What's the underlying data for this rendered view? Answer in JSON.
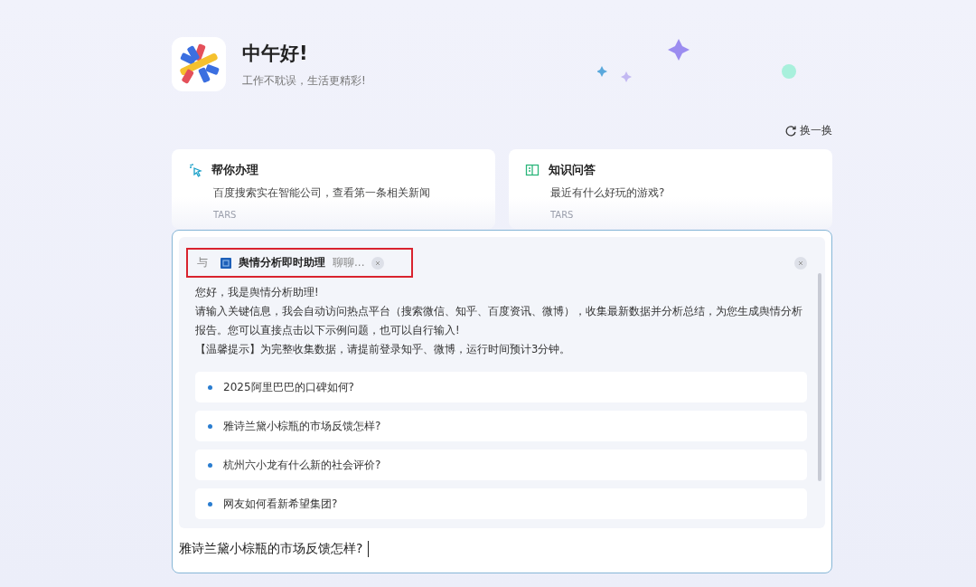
{
  "header": {
    "greeting": "中午好!",
    "subtitle": "工作不耽误，生活更精彩!"
  },
  "refresh_button": {
    "label": "换一换"
  },
  "cards": [
    {
      "kind": "task",
      "title": "帮你办理",
      "text": "百度搜索实在智能公司，查看第一条相关新闻",
      "source": "TARS"
    },
    {
      "kind": "knowledge",
      "title": "知识问答",
      "text": "最近有什么好玩的游戏?",
      "source": "TARS"
    }
  ],
  "chat": {
    "agent_bar": {
      "prefix": "与",
      "agent_name": "舆情分析即时助理",
      "suffix": "聊聊...",
      "highlighted": true
    },
    "intro": [
      "您好，我是舆情分析助理!",
      "请输入关键信息，我会自动访问热点平台（搜索微信、知乎、百度资讯、微博），收集最新数据并分析总结，为您生成舆情分析报告。您可以直接点击以下示例问题，也可以自行输入!",
      "【温馨提示】为完整收集数据，请提前登录知乎、微博，运行时间预计3分钟。"
    ],
    "suggestions": [
      "2025阿里巴巴的口碑如何?",
      "雅诗兰黛小棕瓶的市场反馈怎样?",
      "杭州六小龙有什么新的社会评价?",
      "网友如何看新希望集团?"
    ],
    "input_value": "雅诗兰黛小棕瓶的市场反馈怎样?"
  }
}
